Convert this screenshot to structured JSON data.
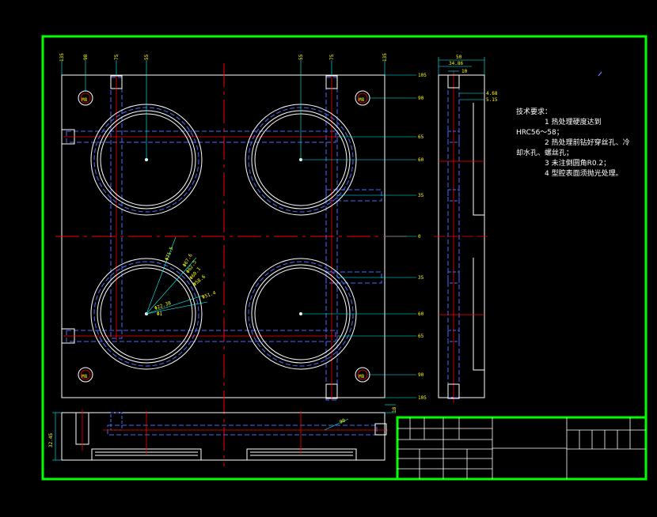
{
  "drawing": {
    "colors": {
      "background": "#000000",
      "frame": "#00ff00",
      "outline": "#ffffff",
      "centerline": "#ff0000",
      "hidden": "#4a6bff",
      "dimension": "#00ffff",
      "dim_text": "#ffff00",
      "callout": "#ffff00"
    },
    "top_dims": [
      "135",
      "98",
      "75",
      "55",
      "55",
      "75",
      "135"
    ],
    "right_dims": [
      "105",
      "90",
      "65",
      "60",
      "35",
      "0",
      "35",
      "60",
      "65",
      "90",
      "105"
    ],
    "hole_callouts": [
      "M8",
      "M8",
      "M8",
      "M8"
    ],
    "cavity_dims": [
      "Φ71.5",
      "Φ67.6",
      "Φ62.5",
      "Φ60.1",
      "Φ58.6",
      "Φ51.4",
      "Φ22.38",
      "Φ1"
    ],
    "side_dims": [
      "50",
      "34.86",
      "10",
      "4.68",
      "5.15"
    ],
    "bottom_dims": [
      "32.45",
      "18",
      "90"
    ],
    "tech_notes": {
      "title": "技术要求：",
      "lines": [
        "1  热处理硬度达到",
        "HRC56～58；",
        "2  热处理前钻好穿丝孔、冷",
        "却水孔、螺丝孔；",
        "3  未注倒圆角R0.2；",
        "4  型腔表面须抛光处理。"
      ]
    }
  }
}
